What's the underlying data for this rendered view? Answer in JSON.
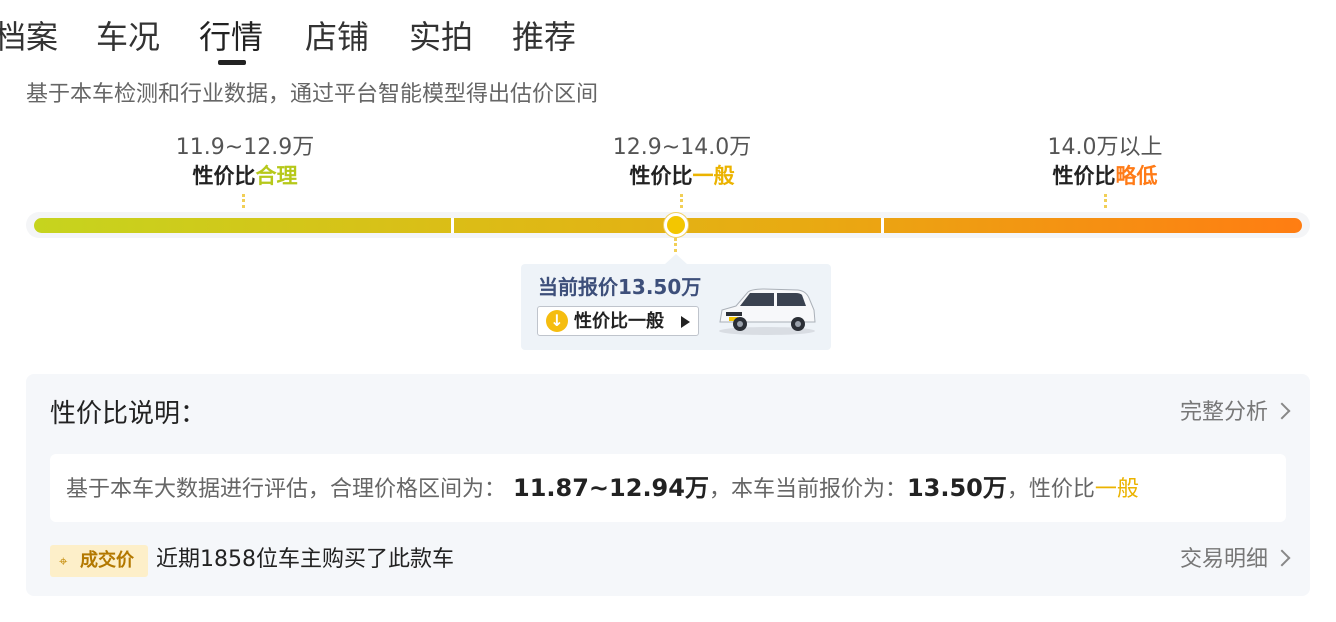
{
  "tabs": [
    {
      "label": "档案"
    },
    {
      "label": "车况"
    },
    {
      "label": "行情",
      "active": true
    },
    {
      "label": "店铺"
    },
    {
      "label": "实拍"
    },
    {
      "label": "推荐"
    }
  ],
  "description": "基于本车检测和行业数据，通过平台智能模型得出估价区间",
  "segments": [
    {
      "range": "11.9~12.9万",
      "prefix": "性价比",
      "rating": "合理",
      "color": "#b6c81a"
    },
    {
      "range": "12.9~14.0万",
      "prefix": "性价比",
      "rating": "一般",
      "color": "#ebb300"
    },
    {
      "range": "14.0万以上",
      "prefix": "性价比",
      "rating": "略低",
      "color": "#ff7b17"
    }
  ],
  "current": {
    "price_text": "当前报价13.50万",
    "button_label": "性价比一般"
  },
  "panel": {
    "title": "性价比说明：",
    "full_analysis": "完整分析",
    "summary_prefix": "基于本车大数据进行评估，合理价格区间为：",
    "summary_range": "11.87~12.94万",
    "summary_mid": "，本车当前报价为：",
    "summary_price": "13.50万",
    "summary_tail_prefix": "，性价比",
    "summary_rating": "一般",
    "deal_badge": "成交价",
    "deal_text": "近期1858位车主购买了此款车",
    "trade_details": "交易明细"
  },
  "colors": {
    "accent_yellow": "#ebb300",
    "accent_green": "#b6c81a",
    "accent_orange": "#ff7b17"
  }
}
